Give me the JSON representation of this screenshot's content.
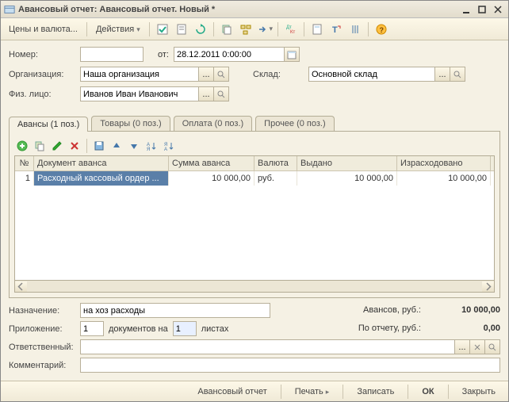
{
  "window": {
    "title": "Авансовый отчет: Авансовый отчет. Новый *"
  },
  "toolbar": {
    "prices": "Цены и валюта...",
    "actions": "Действия"
  },
  "form": {
    "number_label": "Номер:",
    "number": "",
    "date_label": "от:",
    "date": "28.12.2011 0:00:00",
    "org_label": "Организация:",
    "org": "Наша организация",
    "warehouse_label": "Склад:",
    "warehouse": "Основной склад",
    "person_label": "Физ. лицо:",
    "person": "Иванов Иван Иванович"
  },
  "tabs": {
    "t0": "Авансы (1 поз.)",
    "t1": "Товары (0 поз.)",
    "t2": "Оплата (0 поз.)",
    "t3": "Прочее (0 поз.)"
  },
  "grid": {
    "h_n": "№",
    "h_doc": "Документ аванса",
    "h_sum": "Сумма аванса",
    "h_cur": "Валюта",
    "h_iss": "Выдано",
    "h_sp": "Израсходовано",
    "rows": [
      {
        "n": "1",
        "doc": "Расходный кассовый ордер ...",
        "sum": "10 000,00",
        "cur": "руб.",
        "iss": "10 000,00",
        "sp": "10 000,00"
      }
    ]
  },
  "bottom": {
    "purpose_label": "Назначение:",
    "purpose": "на хоз расходы",
    "attach_label": "Приложение:",
    "attach_count": "1",
    "attach_mid": "документов на",
    "attach_pages": "1",
    "attach_suffix": "листах",
    "resp_label": "Ответственный:",
    "resp": "",
    "comment_label": "Комментарий:",
    "comment": "",
    "avans_label": "Авансов, руб.:",
    "avans_val": "10 000,00",
    "report_label": "По отчету, руб.:",
    "report_val": "0,00"
  },
  "footer": {
    "report": "Авансовый отчет",
    "print": "Печать",
    "save": "Записать",
    "ok": "ОК",
    "close": "Закрыть"
  }
}
